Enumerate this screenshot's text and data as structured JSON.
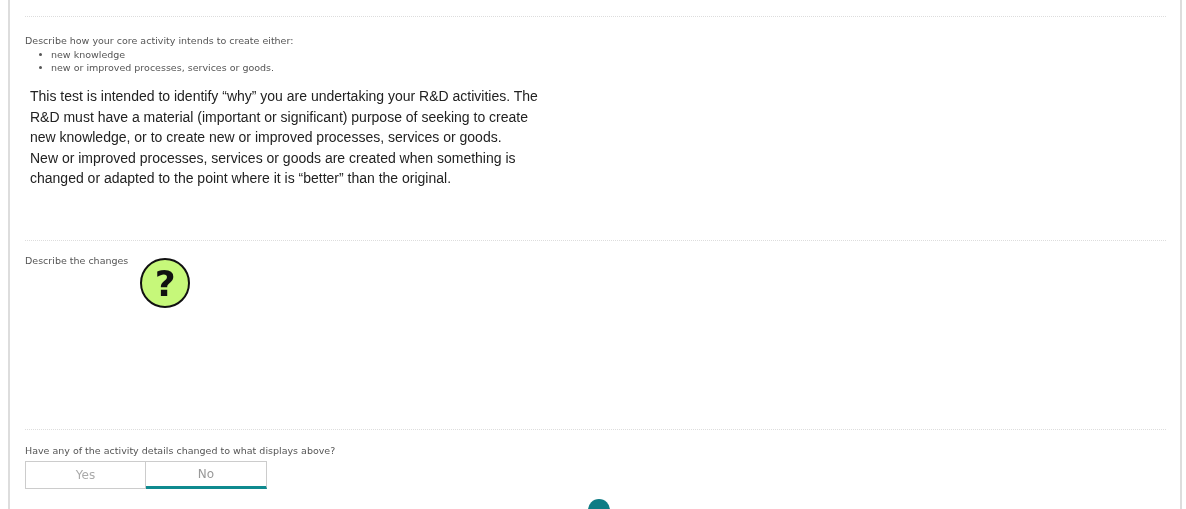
{
  "core_activity": {
    "label": "Describe how your core activity intends to create either:",
    "bullets": [
      "new knowledge",
      "new or improved processes, services or goods."
    ],
    "guidance": [
      "This test is intended to identify “why” you are undertaking your R&D activities. The R&D must have a material (important or significant) purpose of seeking to create new knowledge, or to create new or improved processes, services or goods.",
      "New or improved processes, services or goods are created when something is changed or adapted to the point where it is “better” than the original."
    ]
  },
  "changes": {
    "label": "Describe the changes",
    "help": "?"
  },
  "details_changed": {
    "label": "Have any of the activity details changed to what displays above?",
    "options": [
      {
        "label": "Yes",
        "selected": false
      },
      {
        "label": "No",
        "selected": true
      }
    ]
  }
}
